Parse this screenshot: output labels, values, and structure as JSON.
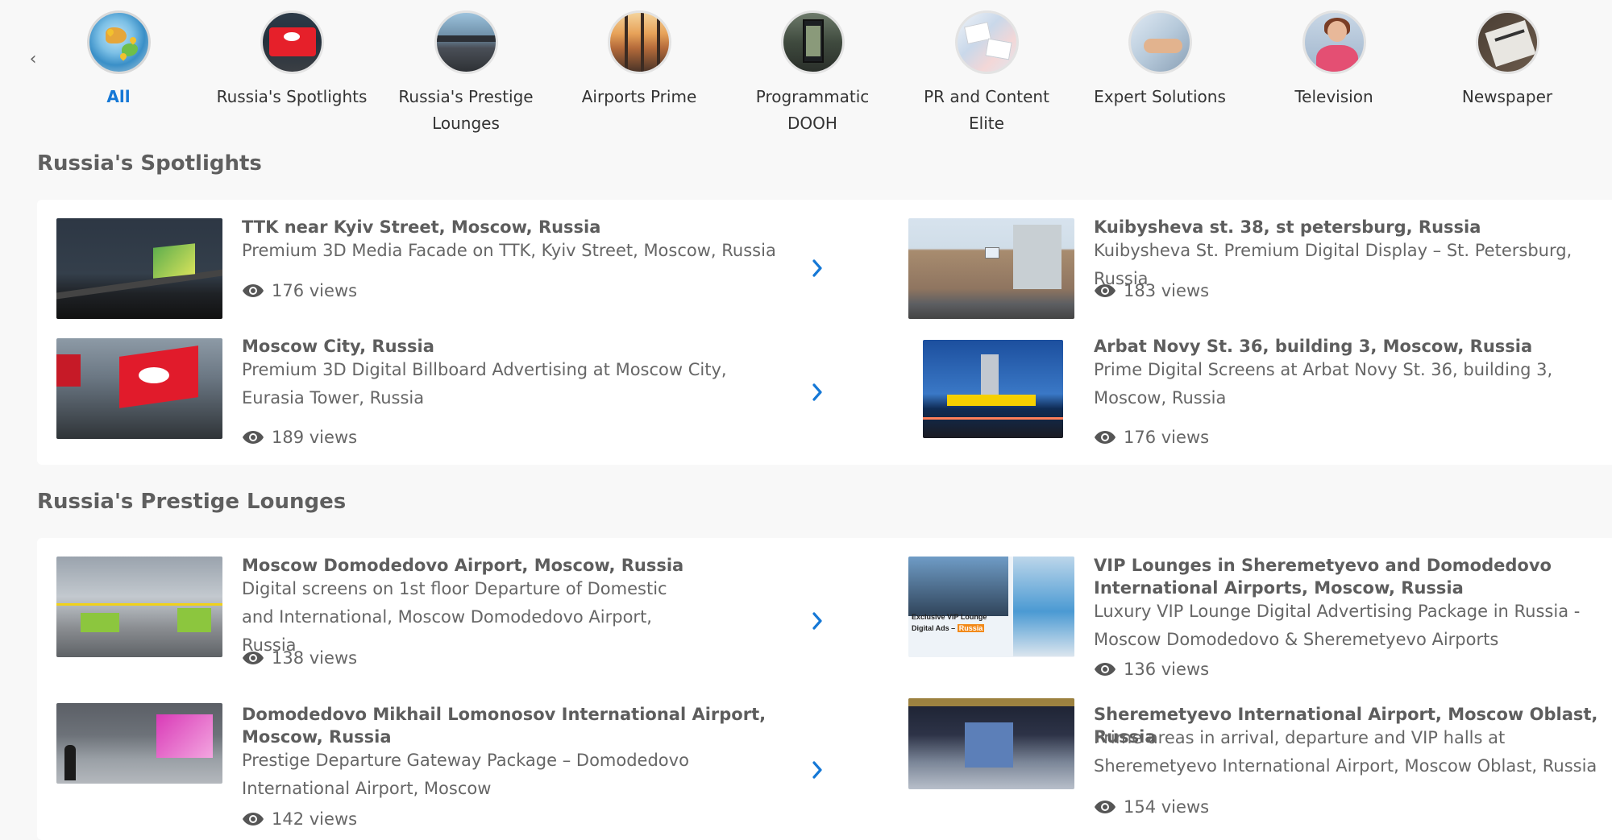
{
  "nav": {
    "scroll_left_glyph": "‹",
    "categories": [
      {
        "label": "All",
        "icon": "globe-icon",
        "active": true
      },
      {
        "label": "Russia's Spotlights",
        "icon": "billboard-icon",
        "active": false
      },
      {
        "label": "Russia's Prestige Lounges",
        "icon": "lounge-icon",
        "active": false
      },
      {
        "label": "Airports Prime",
        "icon": "airport-icon",
        "active": false
      },
      {
        "label": "Programmatic DOOH",
        "icon": "digital-screen-icon",
        "active": false
      },
      {
        "label": "PR and Content Elite",
        "icon": "documents-icon",
        "active": false
      },
      {
        "label": "Expert Solutions",
        "icon": "handshake-icon",
        "active": false
      },
      {
        "label": "Television",
        "icon": "television-icon",
        "active": false
      },
      {
        "label": "Newspaper",
        "icon": "newspaper-icon",
        "active": false
      }
    ]
  },
  "sections": [
    {
      "title": "Russia's Spotlights",
      "items": [
        {
          "title": "TTK near Kyiv Street, Moscow, Russia",
          "description": "Premium 3D Media Facade on TTK, Kyiv Street, Moscow, Russia",
          "views": "176 views"
        },
        {
          "title": "Kuibysheva st. 38, st petersburg, Russia",
          "description": "Kuibysheva St. Premium Digital Display – St. Petersburg, Russia",
          "views": "183 views"
        },
        {
          "title": "Moscow City, Russia",
          "description": "Premium 3D Digital Billboard Advertising at Moscow City, Eurasia Tower, Russia",
          "views": "189 views"
        },
        {
          "title": "Arbat Novy St. 36, building 3, Moscow, Russia",
          "description": "Prime Digital Screens at Arbat Novy St. 36, building 3, Moscow, Russia",
          "views": "176 views"
        }
      ]
    },
    {
      "title": "Russia's Prestige Lounges",
      "items": [
        {
          "title": "Moscow Domodedovo Airport, Moscow, Russia",
          "description": "Digital screens on 1st floor Departure of Domestic and International, Moscow Domodedovo Airport, Russia",
          "views": "138 views"
        },
        {
          "title": "VIP Lounges in Sheremetyevo and Domodedovo International Airports, Moscow, Russia",
          "description": "Luxury VIP Lounge Digital Advertising Package in Russia - Moscow Domodedovo & Sheremetyevo Airports",
          "views": "136 views",
          "thumb_text_1": "Exclusive VIP Lounge",
          "thumb_text_2": "Digital Ads –",
          "thumb_tag": "Russia"
        },
        {
          "title": "Domodedovo Mikhail Lomonosov International Airport, Moscow, Russia",
          "description": "Prestige Departure Gateway Package – Domodedovo International Airport, Moscow",
          "views": "142 views"
        },
        {
          "title": "Sheremetyevo International Airport, Moscow Oblast, Russia",
          "description": "Prime areas in arrival, departure and VIP halls at Sheremetyevo International Airport, Moscow Oblast, Russia",
          "views": "154 views"
        }
      ]
    }
  ],
  "colors": {
    "accent": "#1578d6",
    "chevron": "#1578d6",
    "background": "#f8f8f8",
    "panel": "#ffffff"
  }
}
